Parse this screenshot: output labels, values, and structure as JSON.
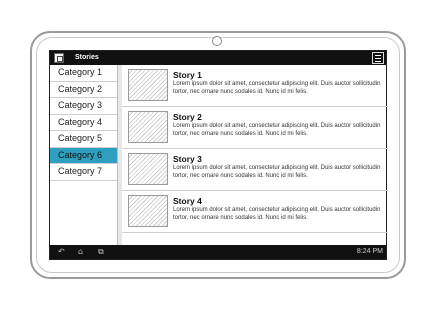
{
  "app": {
    "title": "Stories",
    "icon": "app-logo-icon",
    "menu_icon": "menu-icon"
  },
  "sidebar": {
    "items": [
      {
        "label": "Category 1",
        "active": false
      },
      {
        "label": "Category 2",
        "active": false
      },
      {
        "label": "Category 3",
        "active": false
      },
      {
        "label": "Category 4",
        "active": false
      },
      {
        "label": "Category 5",
        "active": false
      },
      {
        "label": "Category 6",
        "active": true
      },
      {
        "label": "Category 7",
        "active": false
      }
    ],
    "active_color": "#2f9fbf"
  },
  "stories": [
    {
      "title": "Story 1",
      "text": "Lorem ipsum dolor sit amet, consectetur adipiscing elit. Duis auctor sollicitudin tortor, nec ornare nunc sodales id. Nunc id mi felis."
    },
    {
      "title": "Story 2",
      "text": "Lorem ipsum dolor sit amet, consectetur adipiscing elit. Duis auctor sollicitudin tortor, nec ornare nunc sodales id. Nunc id mi felis."
    },
    {
      "title": "Story 3",
      "text": "Lorem ipsum dolor sit amet, consectetur adipiscing elit. Duis auctor sollicitudin tortor, nec ornare nunc sodales id. Nunc id mi felis."
    },
    {
      "title": "Story 4",
      "text": "Lorem ipsum dolor sit amet, consectetur adipiscing elit. Duis auctor sollicitudin tortor, nec ornare nunc sodales id. Nunc id mi felis."
    }
  ],
  "navbar": {
    "icons": [
      "back-icon",
      "home-icon",
      "recent-apps-icon"
    ],
    "time": "8:24 PM"
  }
}
